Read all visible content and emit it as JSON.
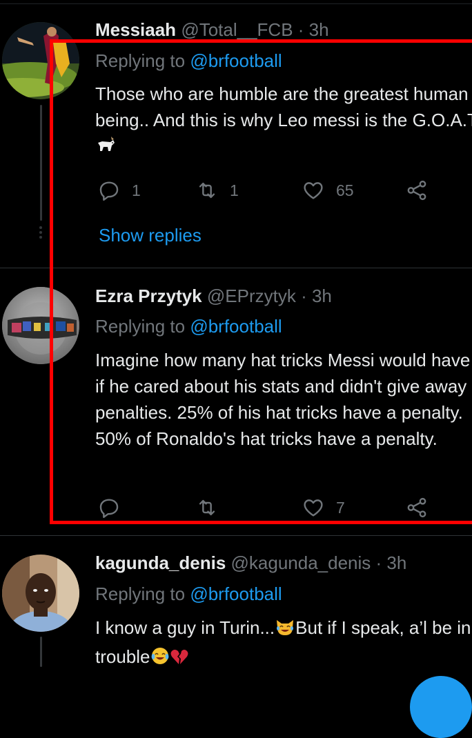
{
  "colors": {
    "background": "#000000",
    "accent": "#1d9bf0",
    "muted": "#71767b",
    "highlight_box": "#ff0000"
  },
  "tweets": [
    {
      "name": "Messiaah",
      "handle": "@Total__FCB · 3h",
      "replying_prefix": "Replying to ",
      "replying_to": "@brfootball",
      "text": "Those who are humble are the greatest human being.. And this is why Leo messi is the G.O.A.T",
      "text_emoji": "goat-emoji",
      "reply_count": "1",
      "retweet_count": "1",
      "like_count": "65",
      "show_replies": "Show replies"
    },
    {
      "name": "Ezra Przytyk",
      "handle": "@EPrzytyk · 3h",
      "replying_prefix": "Replying to ",
      "replying_to": "@brfootball",
      "text": "Imagine how many hat tricks Messi would have if he cared about his stats and didn't give away penalties. 25% of his hat tricks have a penalty. 50% of Ronaldo's hat tricks have a penalty.",
      "reply_count": "",
      "retweet_count": "",
      "like_count": "7"
    },
    {
      "name": "kagunda_denis",
      "handle": "@kagunda_denis · 3h",
      "replying_prefix": "Replying to ",
      "replying_to": "@brfootball",
      "text_part1": "I know a guy in Turin...",
      "text_part2": "But if I speak, a’l be in trouble",
      "emojis": [
        "laughing-cat-emoji",
        "crying-laughing-emoji",
        "broken-heart-emoji"
      ]
    }
  ]
}
